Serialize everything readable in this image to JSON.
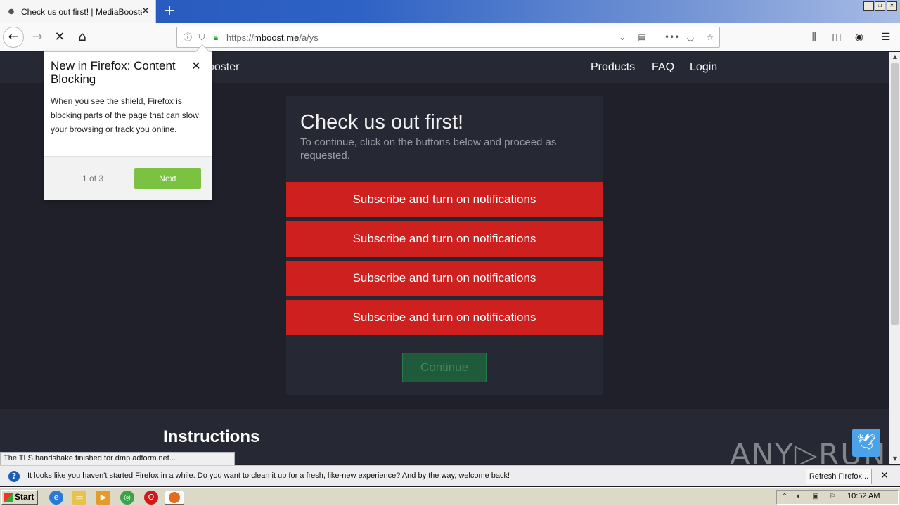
{
  "browser": {
    "tab": {
      "title": "Check us out first! | MediaBooster",
      "favicon": "dot-icon",
      "close": "✕"
    },
    "new_tab": "+",
    "window_controls": [
      "_",
      "❐",
      "✕"
    ],
    "url": {
      "prefix": "https://",
      "host": "mboost.me",
      "path": "/a/ys"
    }
  },
  "site": {
    "brand": "ooster",
    "nav": [
      "Products",
      "FAQ",
      "Login"
    ]
  },
  "card": {
    "title": "Check us out first!",
    "subtitle": "To continue, click on the buttons below and proceed as requested.",
    "buttons": [
      "Subscribe and turn on notifications",
      "Subscribe and turn on notifications",
      "Subscribe and turn on notifications",
      "Subscribe and turn on notifications"
    ],
    "continue": "Continue"
  },
  "instructions": "Instructions",
  "watermark": "ANY▷RUN",
  "status_text": "The TLS handshake finished for dmp.adform.net...",
  "popup": {
    "title": "New in Firefox: Content Blocking",
    "body": "When you see the shield, Firefox is blocking parts of the page that can slow your browsing or track you online.",
    "counter": "1 of 3",
    "next": "Next",
    "close": "✕"
  },
  "notification": {
    "message": "It looks like you haven't started Firefox in a while. Do you want to clean it up for a fresh, like-new experience? And by the way, welcome back!",
    "button": "Refresh Firefox...",
    "close": "✕"
  },
  "taskbar": {
    "start": "Start",
    "clock": "10:52 AM"
  },
  "colors": {
    "subscribe_red": "#cf2020",
    "next_green": "#7bc142",
    "page_bg": "#1f2029"
  }
}
